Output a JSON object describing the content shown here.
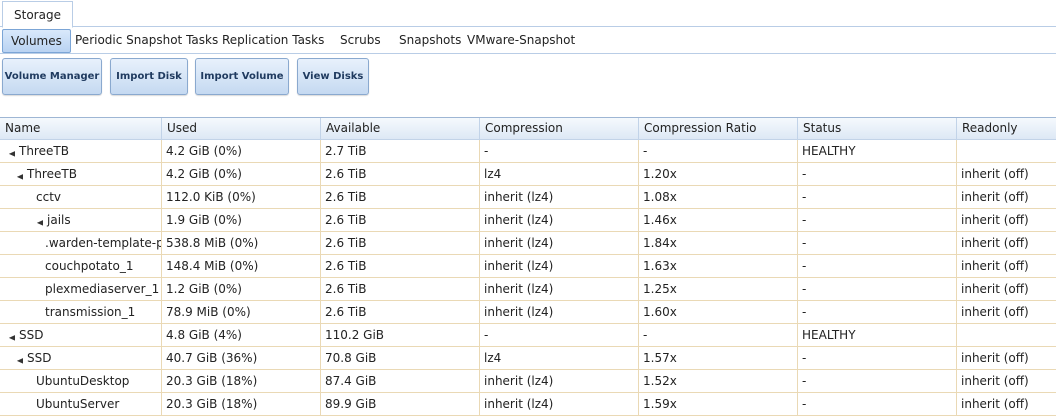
{
  "top_tab": "Storage",
  "subtabs": [
    "Volumes",
    "Periodic Snapshot Tasks",
    "Replication Tasks",
    "Scrubs",
    "Snapshots",
    "VMware-Snapshot"
  ],
  "buttons": [
    "Volume Manager",
    "Import Disk",
    "Import Volume",
    "View Disks"
  ],
  "columns": [
    "Name",
    "Used",
    "Available",
    "Compression",
    "Compression Ratio",
    "Status",
    "Readonly"
  ],
  "rows": [
    {
      "name": "ThreeTB",
      "indent": 0,
      "expander": "▲",
      "used": "4.2 GiB (0%)",
      "available": "2.7 TiB",
      "compression": "-",
      "ratio": "-",
      "status": "HEALTHY",
      "readonly": ""
    },
    {
      "name": "ThreeTB",
      "indent": 1,
      "expander": "▲",
      "used": "4.2 GiB (0%)",
      "available": "2.6 TiB",
      "compression": "lz4",
      "ratio": "1.20x",
      "status": "-",
      "readonly": "inherit (off)"
    },
    {
      "name": "cctv",
      "indent": 2,
      "expander": "",
      "used": "112.0 KiB (0%)",
      "available": "2.6 TiB",
      "compression": "inherit (lz4)",
      "ratio": "1.08x",
      "status": "-",
      "readonly": "inherit (off)"
    },
    {
      "name": "jails",
      "indent": 2,
      "expander": "▲",
      "used": "1.9 GiB (0%)",
      "available": "2.6 TiB",
      "compression": "inherit (lz4)",
      "ratio": "1.46x",
      "status": "-",
      "readonly": "inherit (off)"
    },
    {
      "name": ".warden-template-p",
      "indent": 3,
      "expander": "",
      "used": "538.8 MiB (0%)",
      "available": "2.6 TiB",
      "compression": "inherit (lz4)",
      "ratio": "1.84x",
      "status": "-",
      "readonly": "inherit (off)"
    },
    {
      "name": "couchpotato_1",
      "indent": 3,
      "expander": "",
      "used": "148.4 MiB (0%)",
      "available": "2.6 TiB",
      "compression": "inherit (lz4)",
      "ratio": "1.63x",
      "status": "-",
      "readonly": "inherit (off)"
    },
    {
      "name": "plexmediaserver_1",
      "indent": 3,
      "expander": "",
      "used": "1.2 GiB (0%)",
      "available": "2.6 TiB",
      "compression": "inherit (lz4)",
      "ratio": "1.25x",
      "status": "-",
      "readonly": "inherit (off)"
    },
    {
      "name": "transmission_1",
      "indent": 3,
      "expander": "",
      "used": "78.9 MiB (0%)",
      "available": "2.6 TiB",
      "compression": "inherit (lz4)",
      "ratio": "1.60x",
      "status": "-",
      "readonly": "inherit (off)"
    },
    {
      "name": "SSD",
      "indent": 0,
      "expander": "▲",
      "used": "4.8 GiB (4%)",
      "available": "110.2 GiB",
      "compression": "-",
      "ratio": "-",
      "status": "HEALTHY",
      "readonly": ""
    },
    {
      "name": "SSD",
      "indent": 1,
      "expander": "▲",
      "used": "40.7 GiB (36%)",
      "available": "70.8 GiB",
      "compression": "lz4",
      "ratio": "1.57x",
      "status": "-",
      "readonly": "inherit (off)"
    },
    {
      "name": "UbuntuDesktop",
      "indent": 2,
      "expander": "",
      "used": "20.3 GiB (18%)",
      "available": "87.4 GiB",
      "compression": "inherit (lz4)",
      "ratio": "1.52x",
      "status": "-",
      "readonly": "inherit (off)"
    },
    {
      "name": "UbuntuServer",
      "indent": 2,
      "expander": "",
      "used": "20.3 GiB (18%)",
      "available": "89.9 GiB",
      "compression": "inherit (lz4)",
      "ratio": "1.59x",
      "status": "-",
      "readonly": "inherit (off)"
    }
  ]
}
